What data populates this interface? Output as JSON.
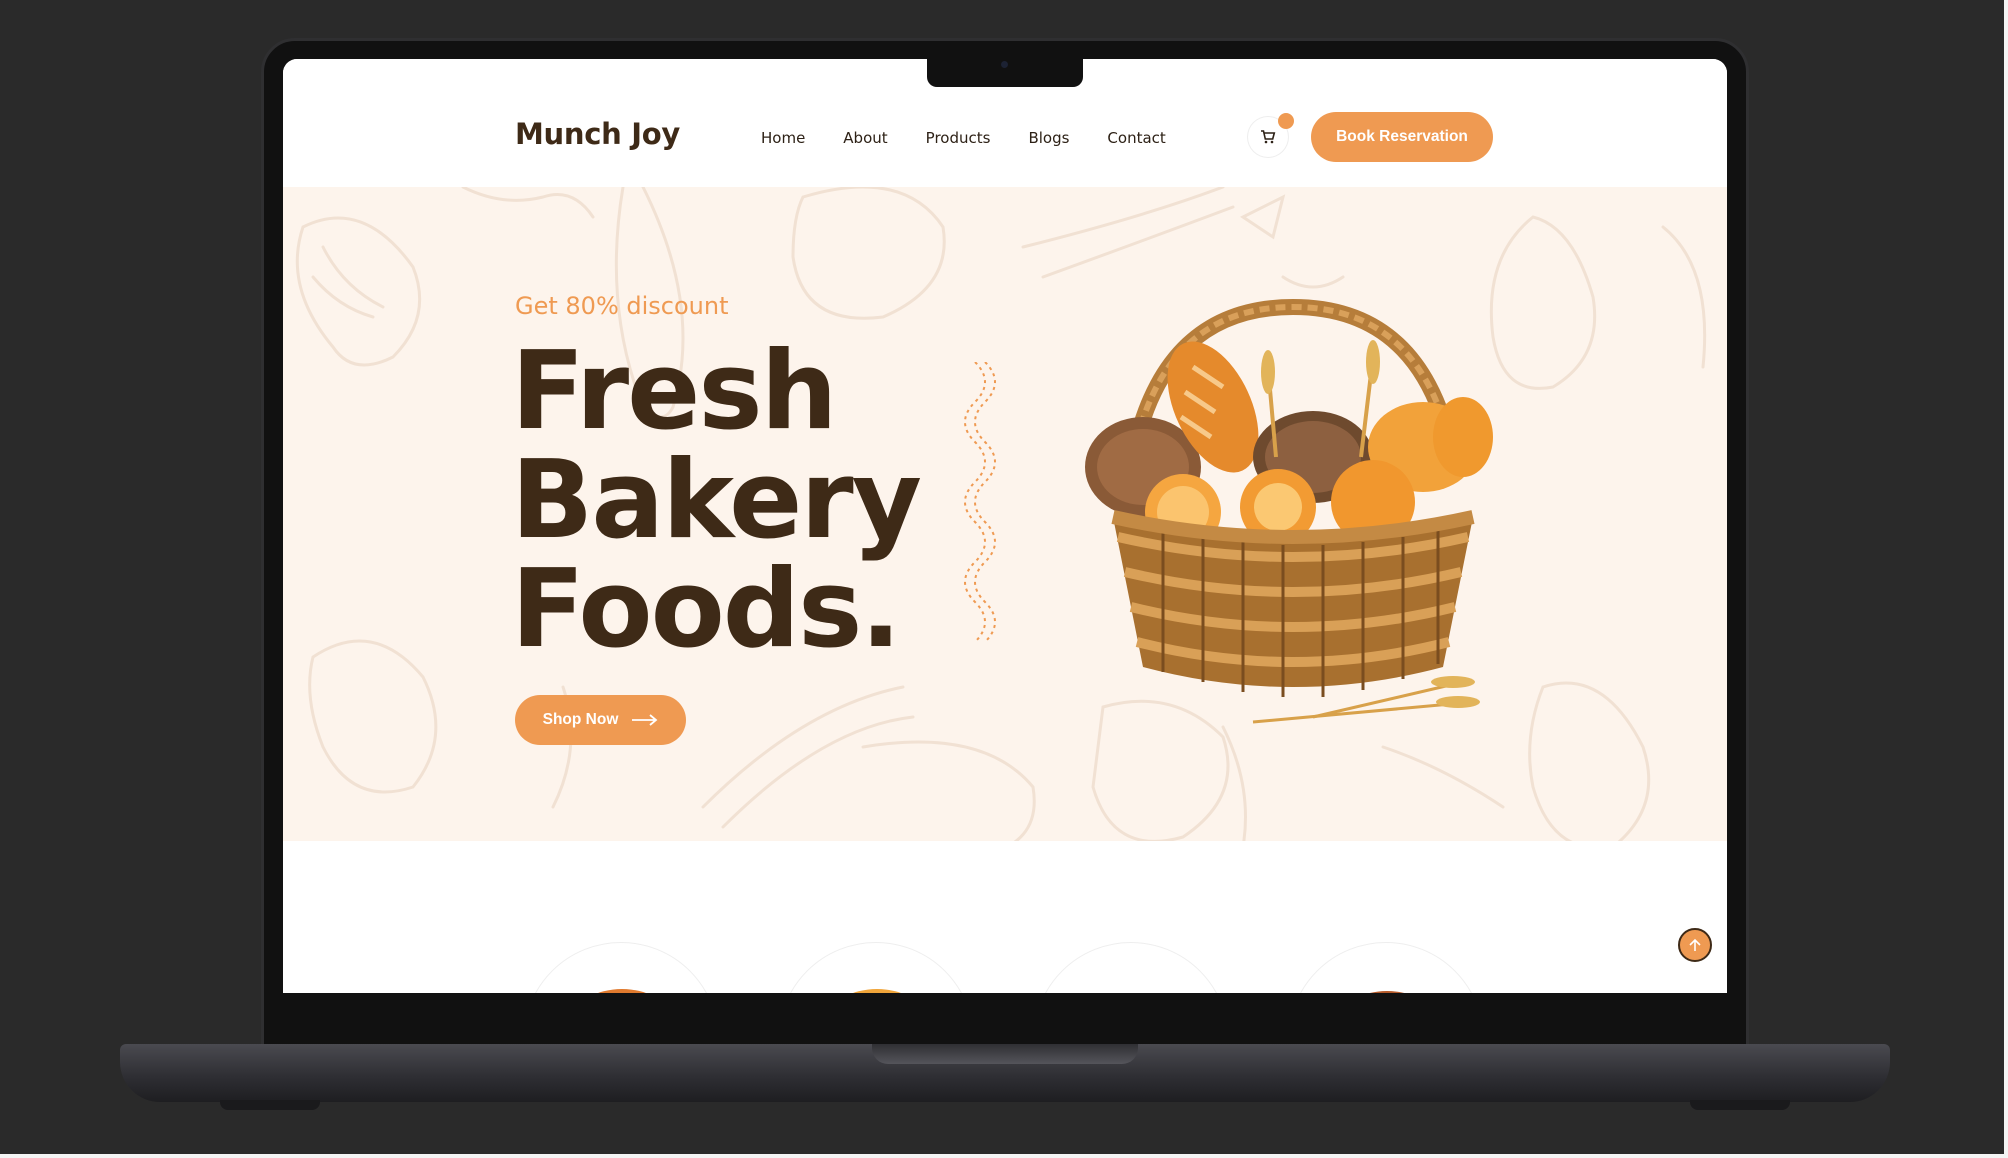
{
  "header": {
    "logo": "Munch Joy",
    "nav": [
      "Home",
      "About",
      "Products",
      "Blogs",
      "Contact"
    ],
    "cart_icon": "cart-icon",
    "cta_label": "Book Reservation"
  },
  "hero": {
    "discount": "Get 80% discount",
    "title_lines": [
      "Fresh",
      "Bakery",
      "Foods."
    ],
    "shop_label": "Shop Now",
    "image": "bread-basket"
  },
  "scroll_top_icon": "arrow-up-icon",
  "colors": {
    "accent": "#ef9a52",
    "brown": "#3e2a17",
    "hero_bg": "#fdf4ec",
    "page_bg": "#2a2a2a"
  }
}
